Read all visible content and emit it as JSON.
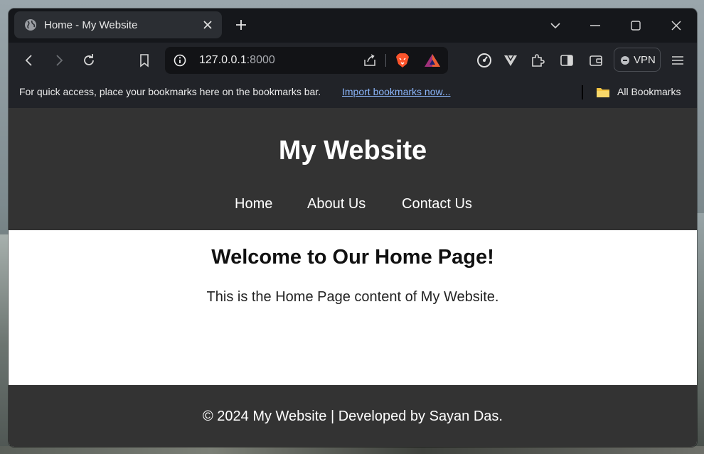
{
  "browser": {
    "tab_title": "Home - My Website",
    "url_host": "127.0.0.1",
    "url_port": ":8000",
    "vpn_label": "VPN",
    "bookmarks_hint": "For quick access, place your bookmarks here on the bookmarks bar.",
    "import_link": "Import bookmarks now...",
    "all_bookmarks": "All Bookmarks",
    "colors": {
      "tabstrip": "#15171b",
      "toolbar": "#212328",
      "link": "#8ab4f8"
    }
  },
  "site": {
    "title": "My Website",
    "nav": [
      "Home",
      "About Us",
      "Contact Us"
    ],
    "heading": "Welcome to Our Home Page!",
    "content": "This is the Home Page content of My Website.",
    "footer": "© 2024 My Website | Developed by Sayan Das.",
    "colors": {
      "header_bg": "#333333",
      "body_bg": "#ffffff"
    }
  }
}
